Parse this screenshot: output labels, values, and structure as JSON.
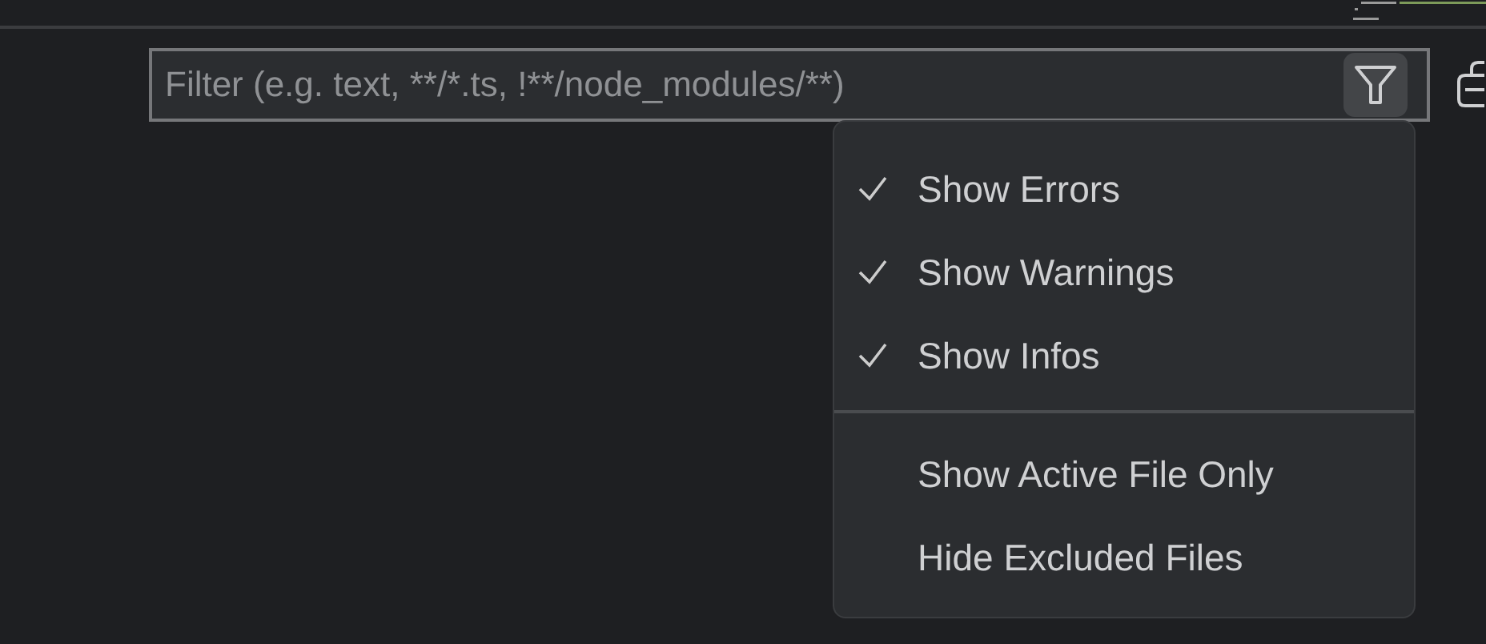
{
  "filter": {
    "placeholder": "Filter (e.g. text, **/*.ts, !**/node_modules/**)",
    "filter_button_active": true
  },
  "menu": {
    "groups": [
      [
        {
          "label": "Show Errors",
          "checked": true
        },
        {
          "label": "Show Warnings",
          "checked": true
        },
        {
          "label": "Show Infos",
          "checked": true
        }
      ],
      [
        {
          "label": "Show Active File Only",
          "checked": false
        },
        {
          "label": "Hide Excluded Files",
          "checked": false
        }
      ]
    ]
  }
}
